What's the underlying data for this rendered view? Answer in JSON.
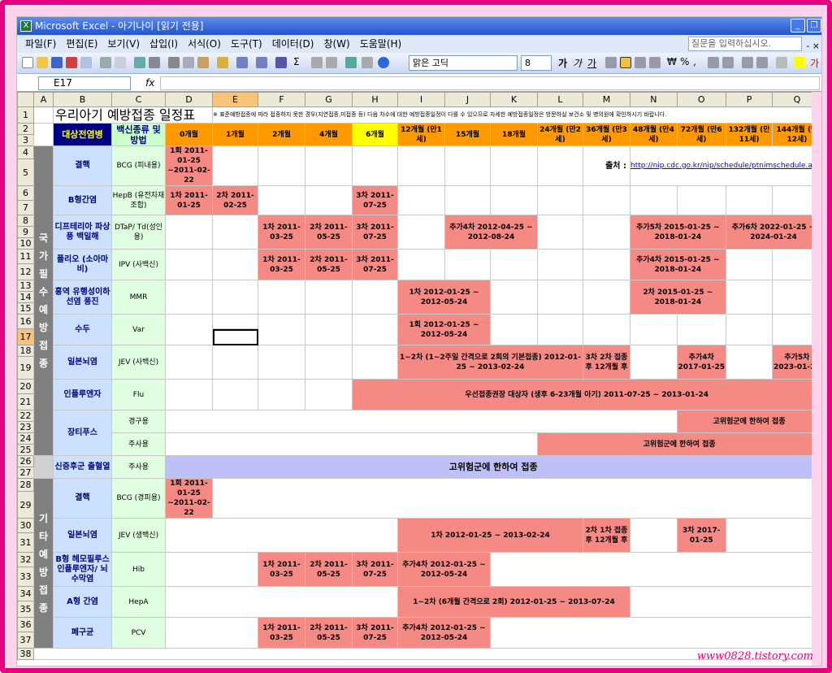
{
  "window": {
    "title": "Microsoft Excel - 아기나이 [읽기 전용]"
  },
  "menu": [
    "파일(F)",
    "편집(E)",
    "보기(V)",
    "삽입(I)",
    "서식(O)",
    "도구(T)",
    "데이터(D)",
    "창(W)",
    "도움말(H)"
  ],
  "help_placeholder": "질문을 입력하십시오.",
  "toolbar": {
    "font": "맑은 고딕",
    "size": "8"
  },
  "namebox": "E17",
  "fx": "fx",
  "columns": [
    "A",
    "B",
    "C",
    "D",
    "E",
    "F",
    "G",
    "H",
    "I",
    "J",
    "K",
    "L",
    "M",
    "N",
    "O",
    "P",
    "Q"
  ],
  "sheet": {
    "title": "우리아기 예방접종 일정표",
    "note": "※ 표준예방접종에 따라 접종하지 못한 경우(지연접종,미접종 등) 다음 차수에 대한 예방접종일정이 다를 수 있으므로 자세한 예방접종일정은 방문하실 보건소 및 병의원에 확인하시기 바랍니다.",
    "header": {
      "disease": "대상전염병",
      "vaccine": "백신종류 및 방법",
      "months": [
        "0개월",
        "1개월",
        "2개월",
        "4개월",
        "6개월",
        "12개월 (만1세)",
        "15개월",
        "18개월",
        "24개월 (만2세)",
        "36개월 (만3세)",
        "48개월 (만4세)",
        "72개월 (만6세)",
        "132개월 (만11세)",
        "144개월 (만12세)"
      ]
    },
    "source_label": "출처 :",
    "source_url": "http://nip.cdc.go.kr/nip/schedule/ptnimschedule.asp",
    "category_national": "국 가 필 수 예 방 접 종",
    "category_other": "기 타 예 방 접 종",
    "rows": {
      "r4": {
        "disease": "결핵",
        "vaccine": "BCG (피내용)",
        "d": "1회 2011-01-25 ~2011-02-22"
      },
      "r6": {
        "disease": "B형간염",
        "vaccine": "HepB (유전자재조합)",
        "d": "1차 2011-01-25",
        "e": "2차 2011-02-25",
        "h": "3차 2011-07-25"
      },
      "r8": {
        "disease": "디프테리아 파상풍 백일해",
        "vaccine": "DTaP/ Td(성인용)",
        "f": "1차 2011-03-25",
        "g": "2차 2011-05-25",
        "h": "3차 2011-07-25",
        "jk": "추가4차 2012-04-25 ~ 2012-08-24",
        "no": "추가5차 2015-01-25 ~ 2018-01-24",
        "pq": "추가6차 2022-01-25 ~ 2024-01-24"
      },
      "r11": {
        "disease": "폴리오 (소아마비)",
        "vaccine": "IPV (사백신)",
        "f": "1차 2011-03-25",
        "g": "2차 2011-05-25",
        "h": "3차 2011-07-25",
        "no": "추가4차 2015-01-25 ~ 2018-01-24"
      },
      "r13": {
        "disease": "홍역 유행성이하선염 풍진",
        "vaccine": "MMR",
        "ij": "1차 2012-01-25 ~ 2012-05-24",
        "no": "2차 2015-01-25 ~ 2018-01-24"
      },
      "r16": {
        "disease": "수두",
        "vaccine": "Var",
        "ij": "1회 2012-01-25 ~ 2012-05-24"
      },
      "r18": {
        "disease": "일본뇌염",
        "vaccine": "JEV (사백신)",
        "il": "1~2차 (1~2주일 간격으로 2회의 기본접종) 2012-01-25 ~ 2013-02-24",
        "m": "3차 2차 접종후 12개월 후",
        "o": "추가4차 2017-01-25",
        "q": "추가5차 2023-01-25"
      },
      "r20": {
        "disease": "인플루엔자",
        "vaccine": "Flu",
        "hq": "우선접종권장 대상자 (생후 6-23개월 아기) 2011-07-25 ~ 2013-01-24"
      },
      "r22": {
        "disease": "장티푸스",
        "vaccine_a": "경구용",
        "op": "고위험군에 한하여 접종",
        "vaccine_b": "주사용",
        "lq": "고위험군에 한하여 접종"
      },
      "r26": {
        "disease": "신증후군 출혈열",
        "vaccine": "주사용",
        "dq": "고위험군에 한하여 접종"
      },
      "r28": {
        "disease": "결핵",
        "vaccine": "BCG (경피용)",
        "d": "1회 2011-01-25 ~2011-02-22"
      },
      "r30": {
        "disease": "일본뇌염",
        "vaccine": "JEV (생백신)",
        "il": "1차 2012-01-25 ~ 2013-02-24",
        "m": "2차 1차 접종후 12개월 후",
        "o": "3차 2017-01-25"
      },
      "r32": {
        "disease": "B형 헤모필루스 인플루엔자/ 뇌수막염",
        "vaccine": "Hib",
        "f": "1차 2011-03-25",
        "g": "2차 2011-05-25",
        "h": "3차 2011-07-25",
        "ij": "추가4차 2012-01-25 ~ 2012-05-24"
      },
      "r34": {
        "disease": "A형 간염",
        "vaccine": "HepA",
        "im": "1~2차 (6개월 간격으로 2회) 2012-01-25 ~ 2013-07-24"
      },
      "r36": {
        "disease": "폐구균",
        "vaccine": "PCV",
        "f": "1차 2011-03-25",
        "g": "2차 2011-05-25",
        "h": "3차 2011-07-25",
        "ij": "추가4차 2012-01-25 ~ 2012-05-24"
      }
    }
  },
  "watermark": "www0828.tistory.com",
  "colors": {
    "event": "#f58a85",
    "header_month": "#ff9900",
    "header_disease": "#000080",
    "vaccine": "#e0ffe0",
    "disease": "#cce0ff",
    "category": "#808080",
    "frame": "#e6007e"
  }
}
